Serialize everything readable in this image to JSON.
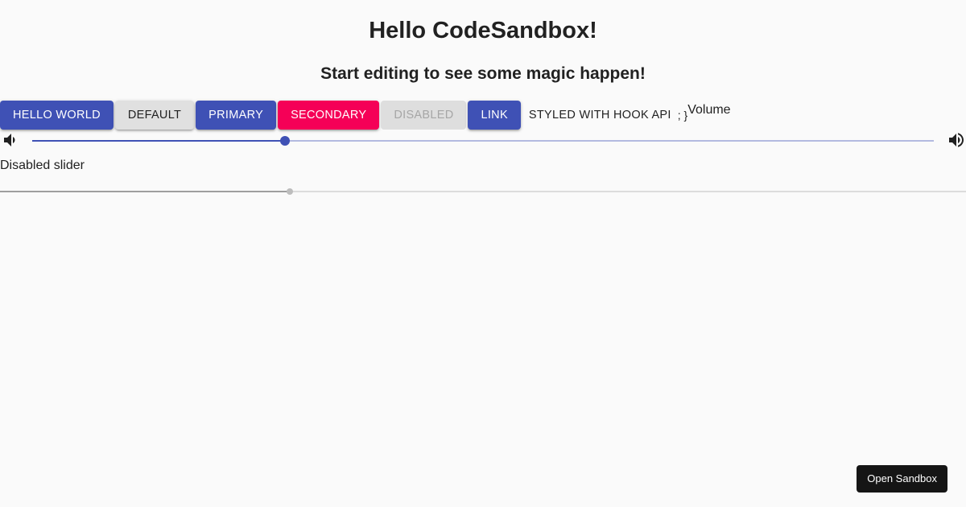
{
  "page": {
    "title": "Hello CodeSandbox!",
    "subtitle": "Start editing to see some magic happen!"
  },
  "buttons": {
    "hello_world": "Hello World",
    "default": "Default",
    "primary": "Primary",
    "secondary": "Secondary",
    "disabled": "Disabled",
    "link": "Link",
    "styled_hook": "Styled with Hook API"
  },
  "trail_text": "; }",
  "volume": {
    "label": "Volume",
    "value_percent": 28,
    "min_icon": "volume-down-icon",
    "max_icon": "volume-up-icon"
  },
  "disabled_slider": {
    "label": "Disabled slider",
    "value_percent": 30
  },
  "sandbox_button": "Open Sandbox",
  "colors": {
    "primary": "#3f51b5",
    "secondary": "#f50057",
    "disabled_bg": "#e0e0e0",
    "disabled_text": "#a6a6a6",
    "background": "#fafafa",
    "text": "#212121",
    "sandbox_bg": "#151515"
  }
}
